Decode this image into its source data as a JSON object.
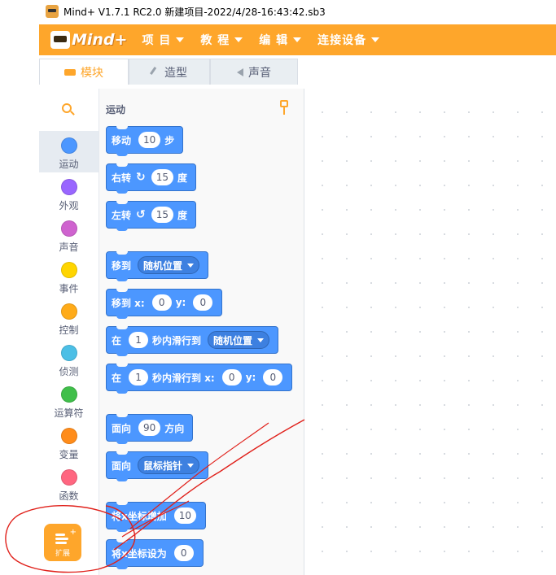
{
  "window": {
    "title": "Mind+ V1.7.1 RC2.0    新建项目-2022/4/28-16:43:42.sb3"
  },
  "menubar": {
    "logo_text": "Mind+",
    "items": [
      "项 目",
      "教 程",
      "编 辑",
      "连接设备"
    ]
  },
  "tabs": [
    {
      "label": "模块",
      "icon": "code-icon",
      "active": true
    },
    {
      "label": "造型",
      "icon": "brush-icon",
      "active": false
    },
    {
      "label": "声音",
      "icon": "speaker-icon",
      "active": false
    }
  ],
  "categories": [
    {
      "label": "运动",
      "color": "#4c97ff",
      "selected": true
    },
    {
      "label": "外观",
      "color": "#9966ff",
      "selected": false
    },
    {
      "label": "声音",
      "color": "#cf63cf",
      "selected": false
    },
    {
      "label": "事件",
      "color": "#ffd500",
      "selected": false
    },
    {
      "label": "控制",
      "color": "#ffab19",
      "selected": false
    },
    {
      "label": "侦测",
      "color": "#4cbfe6",
      "selected": false
    },
    {
      "label": "运算符",
      "color": "#40bf4a",
      "selected": false
    },
    {
      "label": "变量",
      "color": "#ff8c1a",
      "selected": false
    },
    {
      "label": "函数",
      "color": "#ff6680",
      "selected": false
    }
  ],
  "extension": {
    "label": "扩展"
  },
  "palette": {
    "heading": "运动",
    "blocks": {
      "move": {
        "w1": "移动",
        "n1": "10",
        "w2": "步"
      },
      "turn_right": {
        "w1": "右转",
        "n1": "15",
        "w2": "度"
      },
      "turn_left": {
        "w1": "左转",
        "n1": "15",
        "w2": "度"
      },
      "goto": {
        "w1": "移到",
        "dd": "随机位置"
      },
      "goto_xy": {
        "w1": "移到 x:",
        "n1": "0",
        "w2": "y:",
        "n2": "0"
      },
      "glide": {
        "w1": "在",
        "n1": "1",
        "w2": "秒内滑行到",
        "dd": "随机位置"
      },
      "glide_xy": {
        "w1": "在",
        "n1": "1",
        "w2": "秒内滑行到 x:",
        "n2": "0",
        "w3": "y:",
        "n3": "0"
      },
      "point_dir": {
        "w1": "面向",
        "n1": "90",
        "w2": "方向"
      },
      "point_towards": {
        "w1": "面向",
        "dd": "鼠标指针"
      },
      "change_x": {
        "w1": "将x坐标增加",
        "n1": "10"
      },
      "set_x": {
        "w1": "将x坐标设为",
        "n1": "0"
      }
    }
  },
  "colors": {
    "accent": "#fea62b",
    "motion": "#4c97ff",
    "annotation": "#e0201a"
  }
}
